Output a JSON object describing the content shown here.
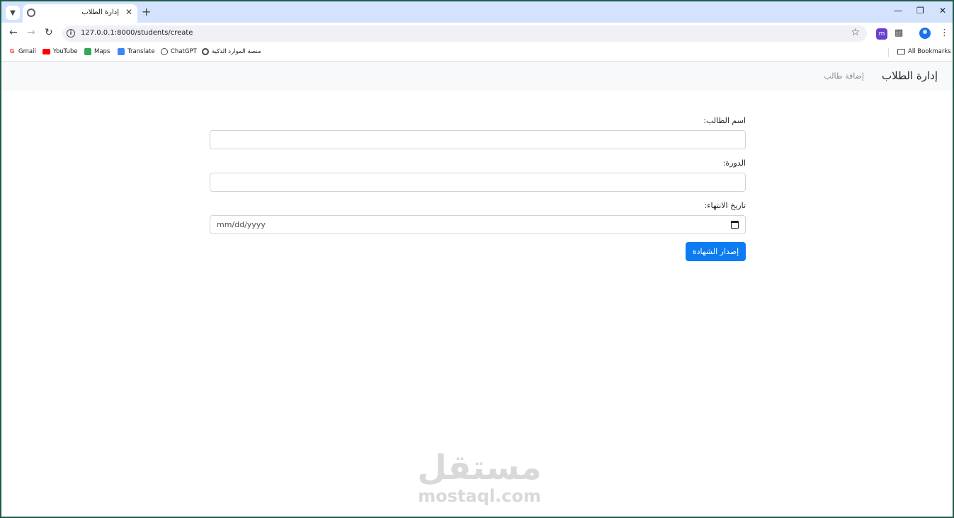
{
  "browser": {
    "tab_title": "إدارة الطلاب",
    "url": "127.0.0.1:8000/students/create",
    "bookmarks": [
      {
        "label": "Gmail",
        "icon": "gmail-icon"
      },
      {
        "label": "YouTube",
        "icon": "youtube-icon"
      },
      {
        "label": "Maps",
        "icon": "maps-icon"
      },
      {
        "label": "Translate",
        "icon": "translate-icon"
      },
      {
        "label": "ChatGPT",
        "icon": "chatgpt-icon"
      },
      {
        "label": "منصة الموارد الذكية",
        "icon": "globe-icon"
      }
    ],
    "all_bookmarks": "All Bookmarks",
    "extension_badge": "m"
  },
  "navbar": {
    "brand": "إدارة الطلاب",
    "link": "إضافة طالب"
  },
  "form": {
    "name_label": "اسم الطالب:",
    "name_value": "",
    "course_label": "الدورة:",
    "course_value": "",
    "end_date_label": "تاريخ الانتهاء:",
    "end_date_placeholder": "mm/dd/yyyy",
    "submit_label": "إصدار الشهادة"
  },
  "watermark": {
    "arabic": "مستقل",
    "english": "mostaql.com"
  },
  "colors": {
    "primary": "#0d7cf2",
    "navbar_bg": "#f8f9fa",
    "tabstrip": "#d3e3fd"
  }
}
